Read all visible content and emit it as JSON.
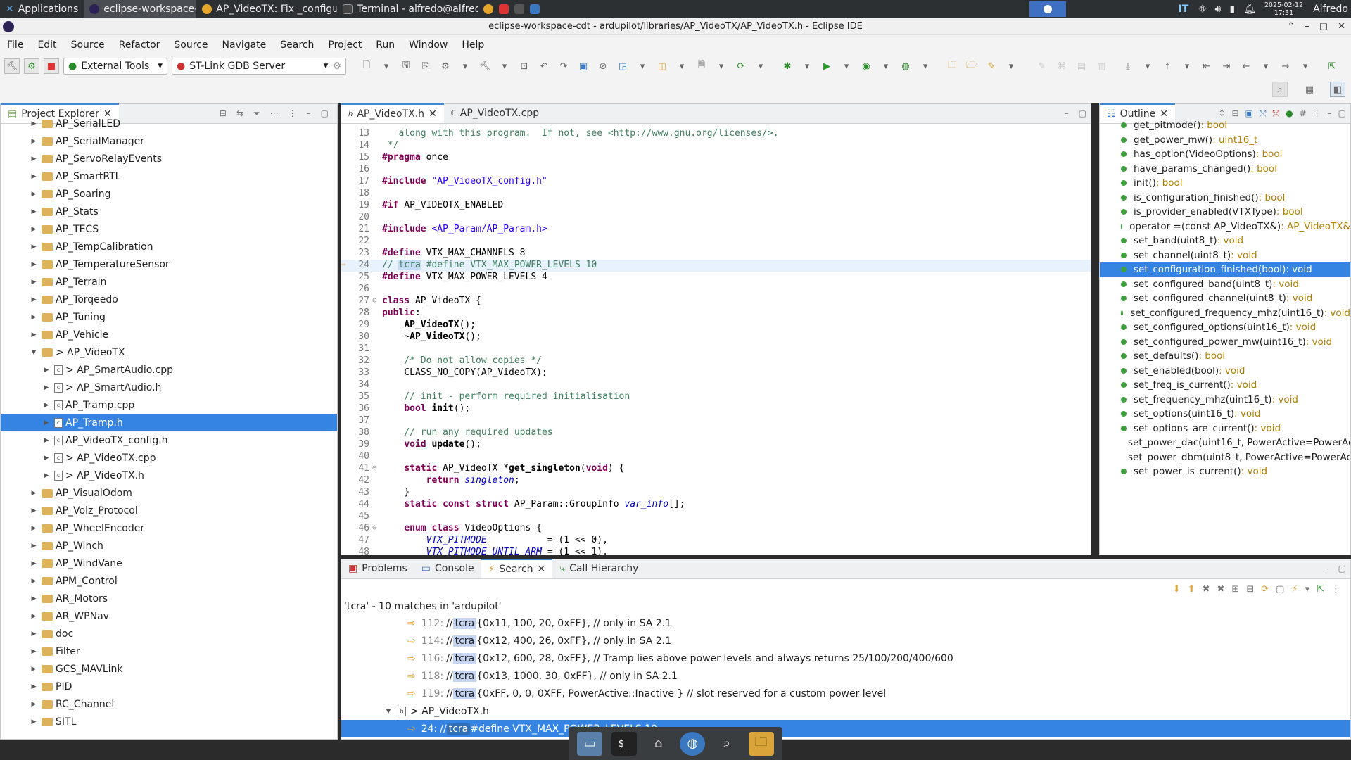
{
  "panel": {
    "applications": "Applications",
    "tasks": [
      "eclipse-workspace-cdt - ar...",
      "AP_VideoTX: Fix _configur...",
      "Terminal - alfredo@alfred..."
    ],
    "keyboard": "IT",
    "date": "2025-02-12",
    "time": "17:31",
    "user": "Alfredo"
  },
  "window": {
    "title": "eclipse-workspace-cdt - ardupilot/libraries/AP_VideoTX/AP_VideoTX.h - Eclipse IDE"
  },
  "menu": [
    "File",
    "Edit",
    "Source",
    "Refactor",
    "Source",
    "Navigate",
    "Search",
    "Project",
    "Run",
    "Window",
    "Help"
  ],
  "toolbar": {
    "external_tools": "External Tools",
    "launch_target": "ST-Link GDB Server"
  },
  "project_explorer": {
    "title": "Project Explorer",
    "items": [
      {
        "label": "AP_SerialLED",
        "kind": "folder",
        "indent": 0
      },
      {
        "label": "AP_SerialManager",
        "kind": "folder",
        "indent": 0
      },
      {
        "label": "AP_ServoRelayEvents",
        "kind": "folder",
        "indent": 0
      },
      {
        "label": "AP_SmartRTL",
        "kind": "folder",
        "indent": 0
      },
      {
        "label": "AP_Soaring",
        "kind": "folder",
        "indent": 0
      },
      {
        "label": "AP_Stats",
        "kind": "folder",
        "indent": 0
      },
      {
        "label": "AP_TECS",
        "kind": "folder",
        "indent": 0
      },
      {
        "label": "AP_TempCalibration",
        "kind": "folder",
        "indent": 0
      },
      {
        "label": "AP_TemperatureSensor",
        "kind": "folder",
        "indent": 0
      },
      {
        "label": "AP_Terrain",
        "kind": "folder",
        "indent": 0
      },
      {
        "label": "AP_Torqeedo",
        "kind": "folder",
        "indent": 0
      },
      {
        "label": "AP_Tuning",
        "kind": "folder",
        "indent": 0
      },
      {
        "label": "AP_Vehicle",
        "kind": "folder",
        "indent": 0
      },
      {
        "label": "> AP_VideoTX",
        "kind": "folder",
        "indent": 0,
        "open": true
      },
      {
        "label": "> AP_SmartAudio.cpp",
        "kind": "file",
        "indent": 1
      },
      {
        "label": "> AP_SmartAudio.h",
        "kind": "file",
        "indent": 1
      },
      {
        "label": "AP_Tramp.cpp",
        "kind": "file",
        "indent": 1
      },
      {
        "label": "AP_Tramp.h",
        "kind": "file",
        "indent": 1,
        "selected": true
      },
      {
        "label": "AP_VideoTX_config.h",
        "kind": "file",
        "indent": 1
      },
      {
        "label": "> AP_VideoTX.cpp",
        "kind": "file",
        "indent": 1
      },
      {
        "label": "> AP_VideoTX.h",
        "kind": "file",
        "indent": 1
      },
      {
        "label": "AP_VisualOdom",
        "kind": "folder",
        "indent": 0
      },
      {
        "label": "AP_Volz_Protocol",
        "kind": "folder",
        "indent": 0
      },
      {
        "label": "AP_WheelEncoder",
        "kind": "folder",
        "indent": 0
      },
      {
        "label": "AP_Winch",
        "kind": "folder",
        "indent": 0
      },
      {
        "label": "AP_WindVane",
        "kind": "folder",
        "indent": 0
      },
      {
        "label": "APM_Control",
        "kind": "folder",
        "indent": 0
      },
      {
        "label": "AR_Motors",
        "kind": "folder",
        "indent": 0
      },
      {
        "label": "AR_WPNav",
        "kind": "folder",
        "indent": 0
      },
      {
        "label": "doc",
        "kind": "folder",
        "indent": 0
      },
      {
        "label": "Filter",
        "kind": "folder",
        "indent": 0
      },
      {
        "label": "GCS_MAVLink",
        "kind": "folder",
        "indent": 0
      },
      {
        "label": "PID",
        "kind": "folder",
        "indent": 0
      },
      {
        "label": "RC_Channel",
        "kind": "folder",
        "indent": 0
      },
      {
        "label": "SITL",
        "kind": "folder",
        "indent": 0
      }
    ]
  },
  "editor": {
    "tabs": [
      "AP_VideoTX.h",
      "AP_VideoTX.cpp"
    ],
    "lines": [
      {
        "n": "13",
        "html": "<span class=\"cm\">   along with this program.  If not, see &lt;http://www.gnu.org/licenses/&gt;.</span>"
      },
      {
        "n": "14",
        "html": "<span class=\"cm\"> */</span>"
      },
      {
        "n": "15",
        "html": "<span class=\"kw\">#pragma</span> once"
      },
      {
        "n": "16",
        "html": ""
      },
      {
        "n": "17",
        "html": "<span class=\"kw\">#include</span> <span class=\"st\">\"AP_VideoTX_config.h\"</span>"
      },
      {
        "n": "18",
        "html": ""
      },
      {
        "n": "19",
        "html": "<span class=\"kw\">#if</span> AP_VIDEOTX_ENABLED"
      },
      {
        "n": "20",
        "html": ""
      },
      {
        "n": "21",
        "html": "<span class=\"kw\">#include</span> <span class=\"st\">&lt;AP_Param/AP_Param.h&gt;</span>"
      },
      {
        "n": "22",
        "html": ""
      },
      {
        "n": "23",
        "html": "<span class=\"kw\">#define</span> VTX_MAX_CHANNELS 8"
      },
      {
        "n": "24",
        "html": "<span class=\"cm\">// <span class=\"mark\">tcra</span> #define VTX_MAX_POWER_LEVELS 10</span>",
        "current": true
      },
      {
        "n": "25",
        "html": "<span class=\"kw\">#define</span> VTX_MAX_POWER_LEVELS 4"
      },
      {
        "n": "26",
        "html": ""
      },
      {
        "n": "27",
        "html": "<span class=\"kw\">class</span> AP_VideoTX {",
        "fold": true
      },
      {
        "n": "28",
        "html": "<span class=\"kw\">public</span>:"
      },
      {
        "n": "29",
        "html": "    <b>AP_VideoTX</b>();"
      },
      {
        "n": "30",
        "html": "    <b>~AP_VideoTX</b>();"
      },
      {
        "n": "31",
        "html": ""
      },
      {
        "n": "32",
        "html": "    <span class=\"cm\">/* Do not allow copies */</span>"
      },
      {
        "n": "33",
        "html": "    CLASS_NO_COPY(AP_VideoTX);"
      },
      {
        "n": "34",
        "html": ""
      },
      {
        "n": "35",
        "html": "    <span class=\"cm\">// init - perform required initialisation</span>"
      },
      {
        "n": "36",
        "html": "    <span class=\"kw\">bool</span> <b>init</b>();"
      },
      {
        "n": "37",
        "html": ""
      },
      {
        "n": "38",
        "html": "    <span class=\"cm\">// run any required updates</span>"
      },
      {
        "n": "39",
        "html": "    <span class=\"kw\">void</span> <b>update</b>();"
      },
      {
        "n": "40",
        "html": ""
      },
      {
        "n": "41",
        "html": "    <span class=\"kw\">static</span> AP_VideoTX *<b>get_singleton</b>(<span class=\"kw\">void</span>) {",
        "fold": true
      },
      {
        "n": "42",
        "html": "        <span class=\"kw\">return</span> <span class=\"it\">singleton</span>;"
      },
      {
        "n": "43",
        "html": "    }"
      },
      {
        "n": "44",
        "html": "    <span class=\"kw\">static</span> <span class=\"kw\">const</span> <span class=\"kw\">struct</span> AP_Param::GroupInfo <span class=\"it\">var_info</span>[];"
      },
      {
        "n": "45",
        "html": ""
      },
      {
        "n": "46",
        "html": "    <span class=\"kw\">enum</span> <span class=\"kw\">class</span> VideoOptions {",
        "fold": true
      },
      {
        "n": "47",
        "html": "        <span class=\"it\">VTX_PITMODE</span>           = (1 &lt;&lt; 0),"
      },
      {
        "n": "48",
        "html": "        <span class=\"it\">VTX_PITMODE_UNTIL_ARM</span> = (1 &lt;&lt; 1),"
      }
    ]
  },
  "outline": {
    "title": "Outline",
    "items": [
      {
        "name": "get_pitmode()",
        "type": " : bool"
      },
      {
        "name": "get_power_mw()",
        "type": " : uint16_t"
      },
      {
        "name": "has_option(VideoOptions)",
        "type": " : bool"
      },
      {
        "name": "have_params_changed()",
        "type": " : bool"
      },
      {
        "name": "init()",
        "type": " : bool"
      },
      {
        "name": "is_configuration_finished()",
        "type": " : bool"
      },
      {
        "name": "is_provider_enabled(VTXType)",
        "type": " : bool"
      },
      {
        "name": "operator =(const AP_VideoTX&)",
        "type": " : AP_VideoTX&"
      },
      {
        "name": "set_band(uint8_t)",
        "type": " : void"
      },
      {
        "name": "set_channel(uint8_t)",
        "type": " : void"
      },
      {
        "name": "set_configuration_finished(bool)",
        "type": " : void",
        "selected": true
      },
      {
        "name": "set_configured_band(uint8_t)",
        "type": " : void"
      },
      {
        "name": "set_configured_channel(uint8_t)",
        "type": " : void"
      },
      {
        "name": "set_configured_frequency_mhz(uint16_t)",
        "type": " : void"
      },
      {
        "name": "set_configured_options(uint16_t)",
        "type": " : void"
      },
      {
        "name": "set_configured_power_mw(uint16_t)",
        "type": " : void"
      },
      {
        "name": "set_defaults()",
        "type": " : bool"
      },
      {
        "name": "set_enabled(bool)",
        "type": " : void"
      },
      {
        "name": "set_freq_is_current()",
        "type": " : void"
      },
      {
        "name": "set_frequency_mhz(uint16_t)",
        "type": " : void"
      },
      {
        "name": "set_options(uint16_t)",
        "type": " : void"
      },
      {
        "name": "set_options_are_current()",
        "type": " : void"
      },
      {
        "name": "set_power_dac(uint16_t, PowerActive=PowerAc",
        "type": ""
      },
      {
        "name": "set_power_dbm(uint8_t, PowerActive=PowerAc",
        "type": ""
      },
      {
        "name": "set_power_is_current()",
        "type": " : void"
      }
    ]
  },
  "bottom": {
    "tabs": [
      "Problems",
      "Console",
      "Search",
      "Call Hierarchy"
    ],
    "summary": "'tcra' - 10 matches in 'ardupilot'",
    "matches": [
      {
        "line": "112:",
        "pre": "//",
        "word": "tcra",
        "post": "  {0x11, 100,  20, 0xFF}, // only in SA 2.1"
      },
      {
        "line": "114:",
        "pre": "//",
        "word": "tcra",
        "post": "  {0x12, 400,  26, 0xFF}, // only in SA 2.1"
      },
      {
        "line": "116:",
        "pre": "//",
        "word": "tcra",
        "post": "  {0x12, 600,  28, 0xFF}, // Tramp lies above power levels and always returns 25/100/200/400/600"
      },
      {
        "line": "118:",
        "pre": "//",
        "word": "tcra",
        "post": "  {0x13, 1000, 30, 0xFF}, // only in SA 2.1"
      },
      {
        "line": "119:",
        "pre": "//",
        "word": "tcra",
        "post": "  {0xFF, 0,    0,  0XFF, PowerActive::Inactive } // slot reserved for a custom power level"
      }
    ],
    "file_group": "> AP_VideoTX.h",
    "selected_match": {
      "line": "24:",
      "pre": "//",
      "word": "tcra",
      "post": " #define VTX_MAX_POWER_LEVELS 10"
    }
  }
}
